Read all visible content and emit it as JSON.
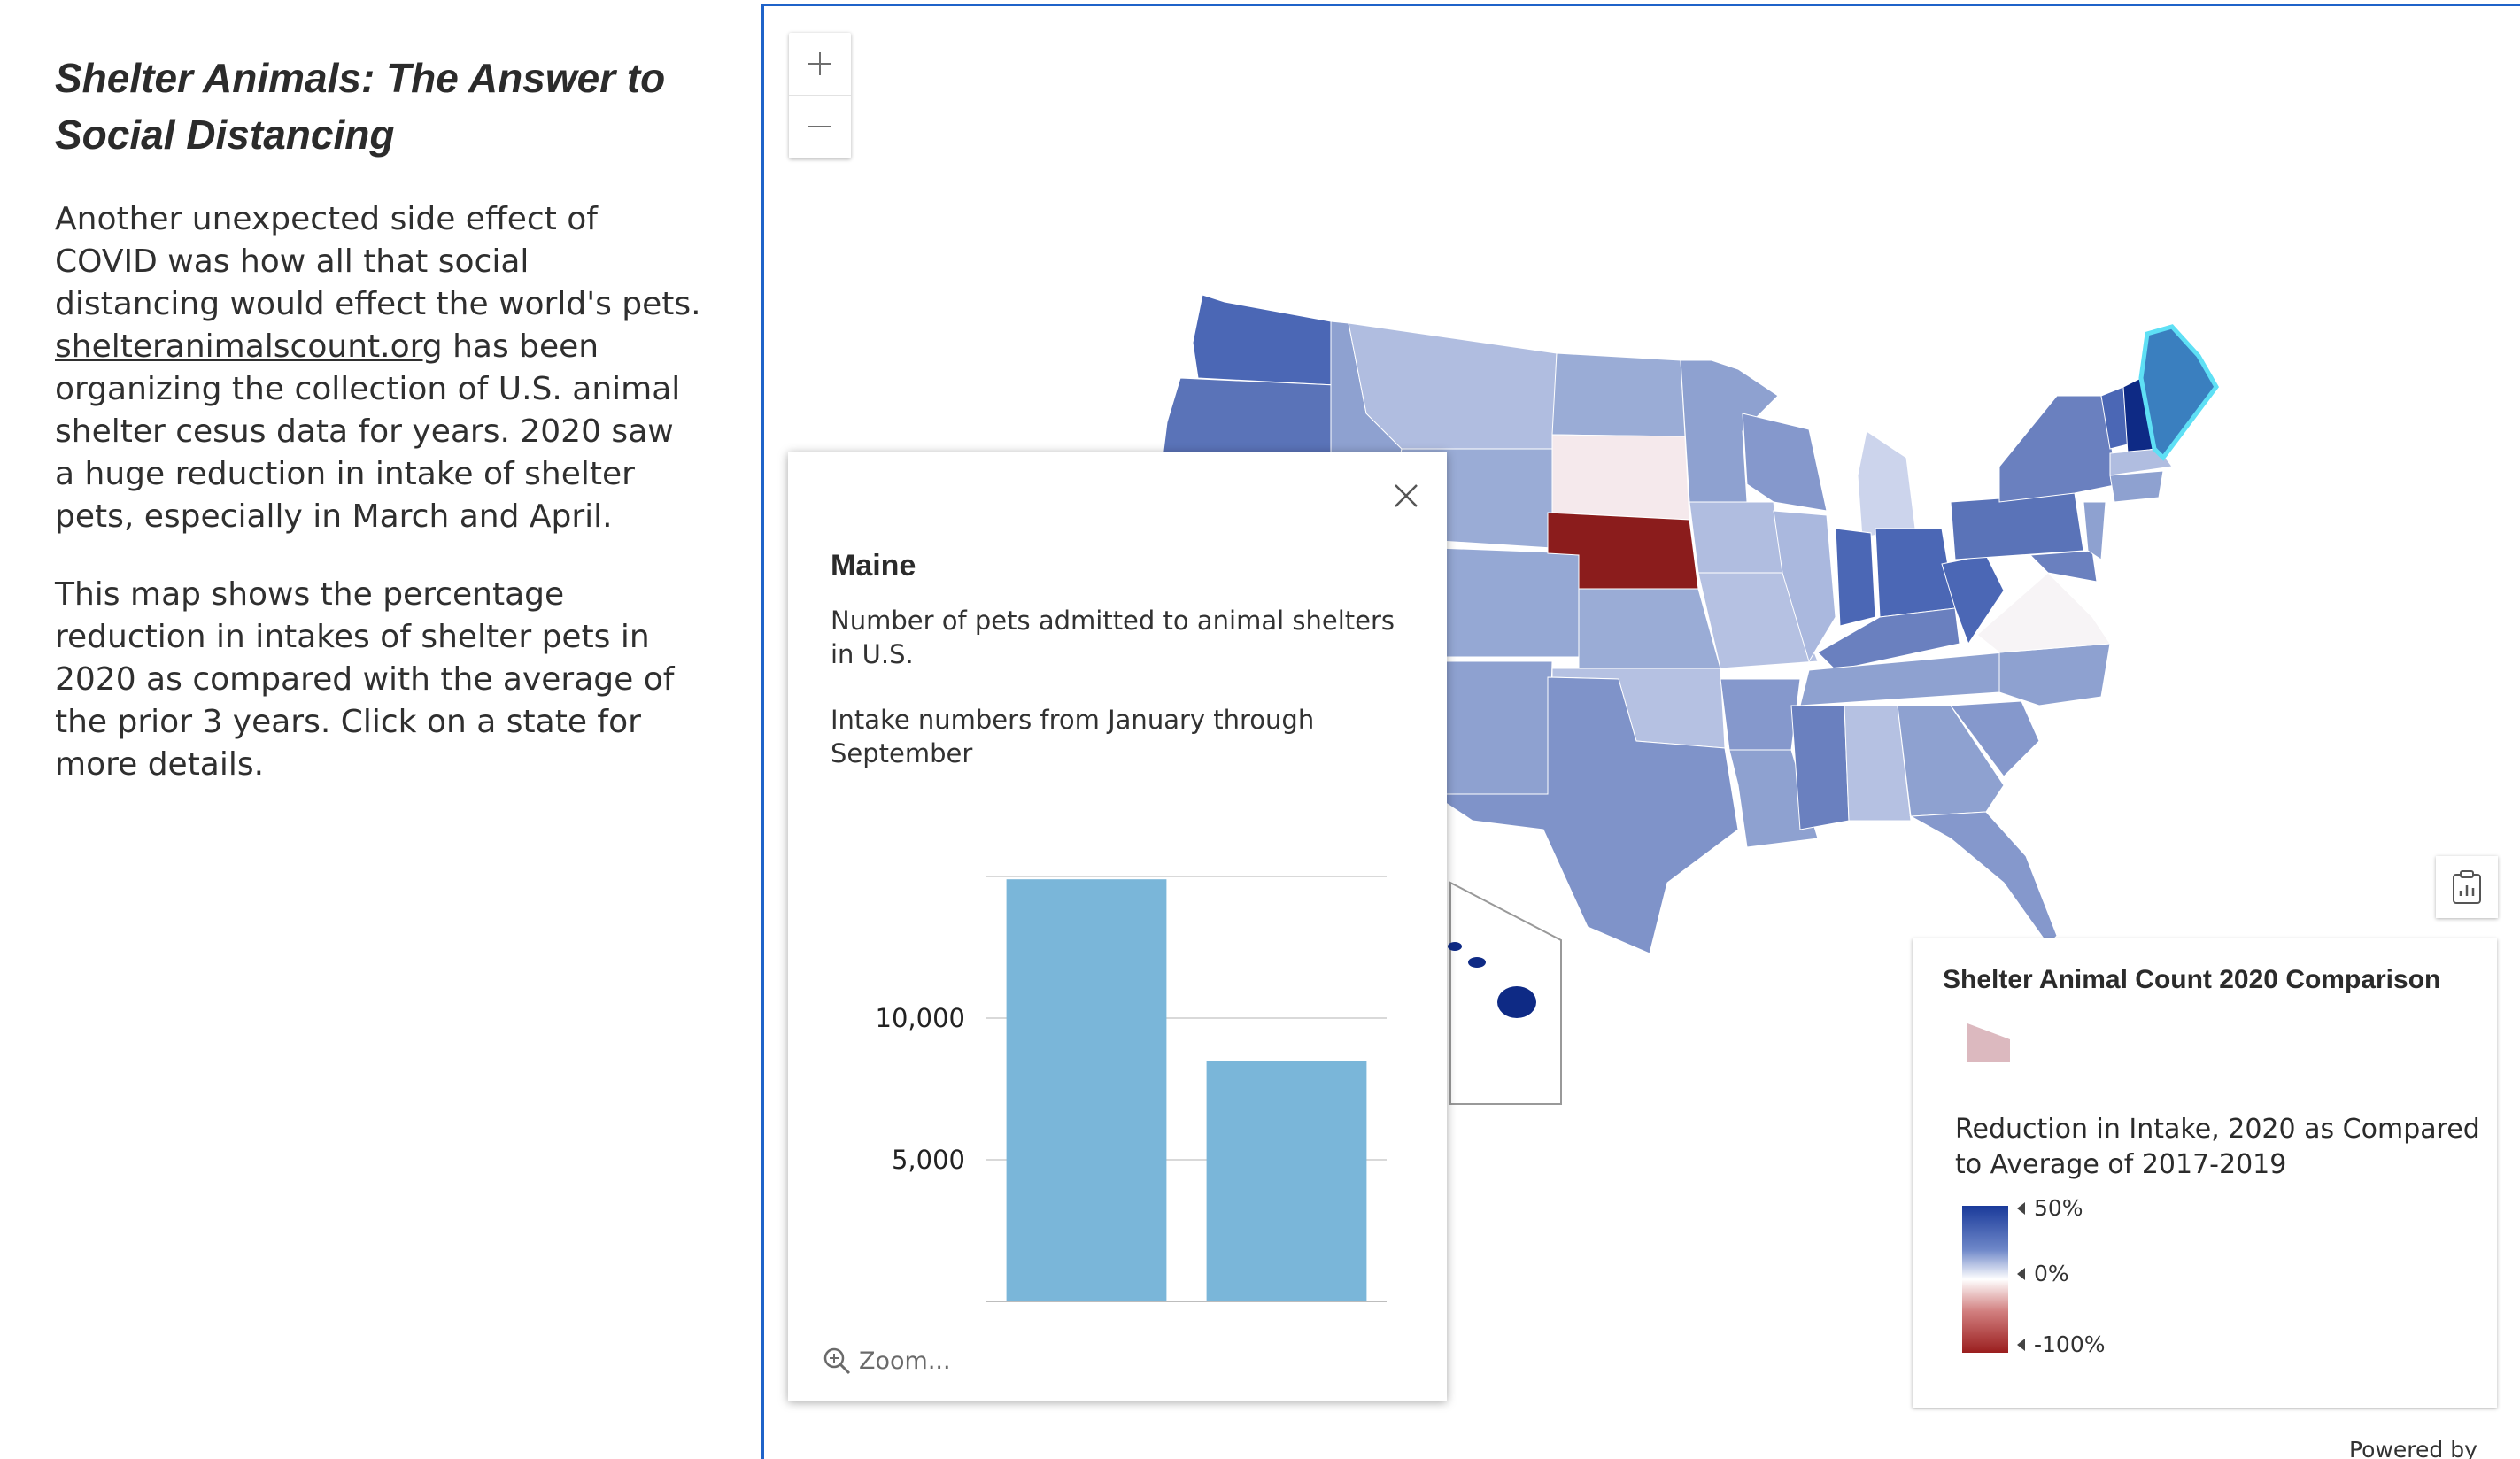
{
  "story": {
    "title": "Shelter Animals: The Answer to Social Distancing",
    "para1_before_link": "Another unexpected side effect of COVID was how all that social distancing would effect the world's pets.",
    "link_text": "shelteranimalscount.org",
    "para1_after_link": "has been organizing the collection of U.S. animal shelter cesus data for years. 2020 saw a huge reduction in intake of shelter pets, especially in March and April.",
    "para2": "This map shows the percentage reduction in intakes of shelter pets in 2020 as compared with the average of the prior 3 years. Click on a state for more details."
  },
  "map": {
    "zoom_in_icon": "plus-icon",
    "zoom_out_icon": "minus-icon",
    "layer_list_icon": "clipboard-chart-icon",
    "selected_state_color": "#3a7fbf",
    "selection_outline_color": "#5ee0f5",
    "attribution": "Powered by Esri"
  },
  "popup": {
    "title": "Maine",
    "description": "Number of pets admitted to animal shelters in U.S.",
    "subtitle": "Intake numbers from January through September",
    "zoom_label": "Zoom...",
    "close_icon": "close-icon",
    "zoom_icon": "zoom-in-icon"
  },
  "chart_data": {
    "type": "bar",
    "categories": [
      "",
      ""
    ],
    "values": [
      14900,
      8500
    ],
    "ylim": [
      0,
      15000
    ],
    "yticks": [
      5000,
      10000
    ],
    "ytick_labels": [
      "5,000",
      "10,000"
    ],
    "bar_color": "#7ab6d9",
    "grid": true,
    "title": "",
    "xlabel": "",
    "ylabel": ""
  },
  "legend": {
    "title": "Shelter Animal Count 2020 Comparison",
    "field_label": "Reduction in Intake, 2020 as Compared to Average of 2017-2019",
    "stops": [
      "50%",
      "0%",
      "-100%"
    ],
    "ramp_colors": [
      "#1a3a9a",
      "#ffffff",
      "#9a1e1e"
    ],
    "swatch_color": "#dcb9bf"
  }
}
